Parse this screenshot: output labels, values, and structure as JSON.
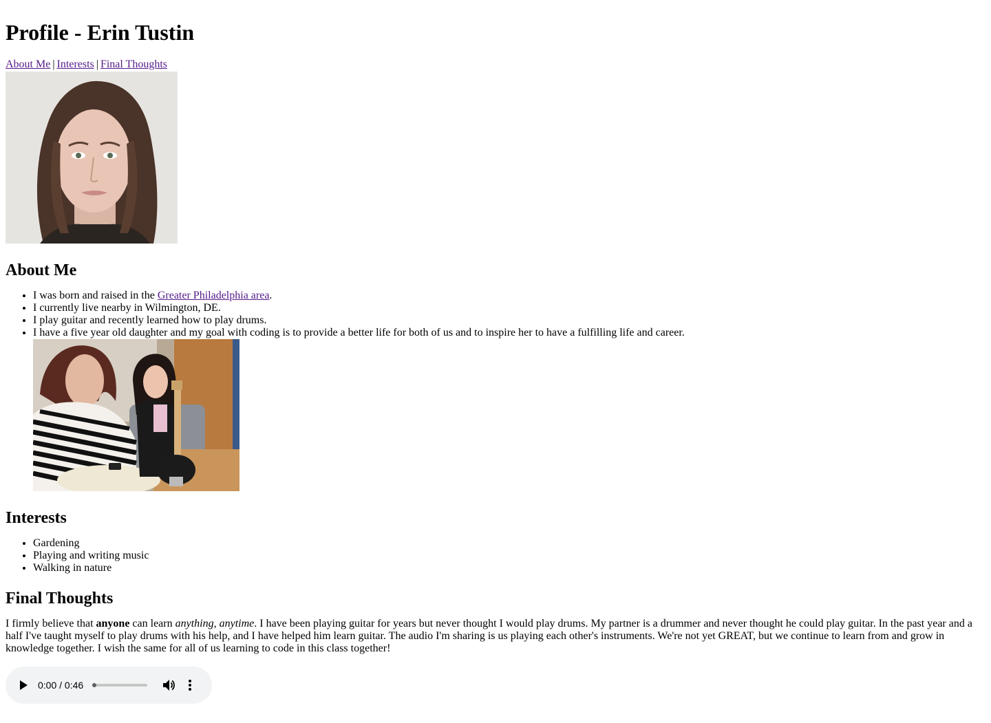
{
  "page": {
    "title": "Profile - Erin Tustin"
  },
  "nav": {
    "items": [
      {
        "label": "About Me"
      },
      {
        "label": "Interests"
      },
      {
        "label": "Final Thoughts"
      }
    ],
    "separator": "|"
  },
  "about": {
    "heading": "About Me",
    "item1_prefix": "I was born and raised in the ",
    "item1_link": "Greater Philadelphia area",
    "item1_suffix": ".",
    "item2": "I currently live nearby in Wilmington, DE.",
    "item3": "I play guitar and recently learned how to play drums.",
    "item4": "I have a five year old daughter and my goal with coding is to provide a better life for both of us and to inspire her to have a fulfilling life and career."
  },
  "interests": {
    "heading": "Interests",
    "items": [
      "Gardening",
      "Playing and writing music",
      "Walking in nature"
    ]
  },
  "final": {
    "heading": "Final Thoughts",
    "p1": "I firmly believe that ",
    "p_bold": "anyone",
    "p2": " can learn ",
    "p_italic": "anything, anytime",
    "p3": ". I have been playing guitar for years but never thought I would play drums. My partner is a drummer and never thought he could play guitar. In the past year and a half I've taught myself to play drums with his help, and I have helped him learn guitar. The audio I'm sharing is us playing each other's instruments. We're not yet GREAT, but we continue to learn from and grow in knowledge together. I wish the same for all of us learning to code in this class together!"
  },
  "audio": {
    "time": "0:00 / 0:46",
    "progress": 0.0,
    "icons": {
      "play": "play-icon",
      "volume": "volume-icon",
      "more": "more-vert-icon"
    }
  },
  "colors": {
    "link": "#551a8b",
    "player_bg": "#f1f3f4"
  }
}
